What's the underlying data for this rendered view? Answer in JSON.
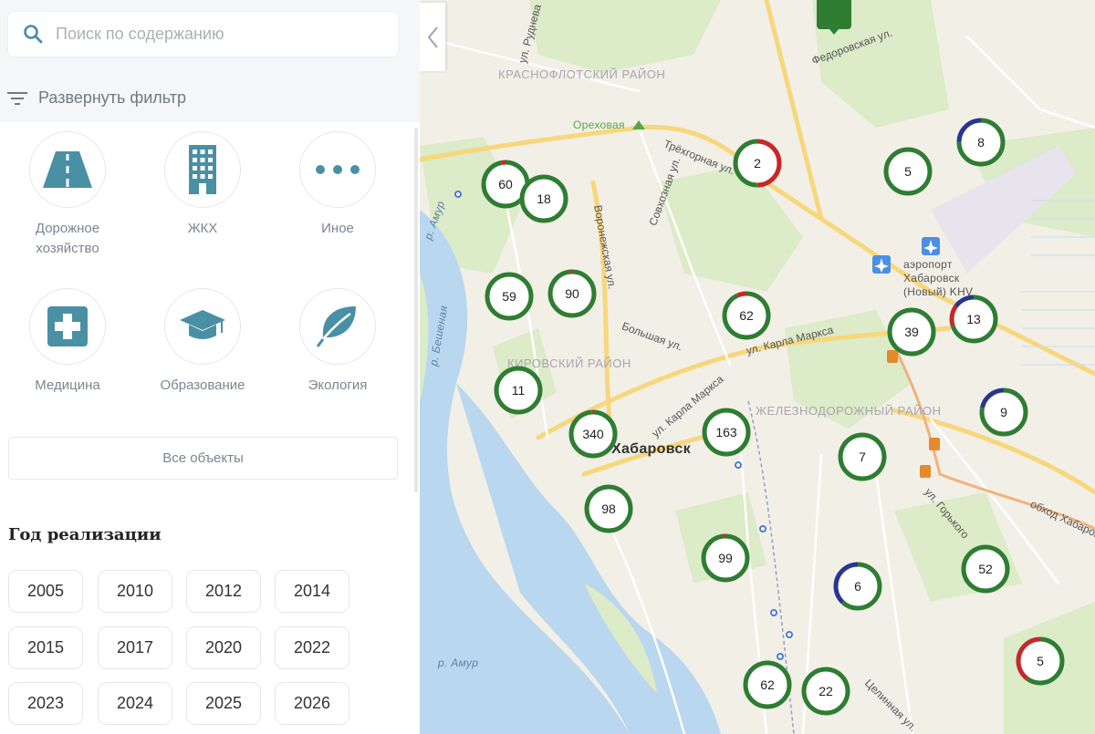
{
  "search": {
    "placeholder": "Поиск по содержанию"
  },
  "filter": {
    "label": "Развернуть фильтр"
  },
  "categories": [
    {
      "label": "Дорожное хозяйство",
      "icon": "road-icon"
    },
    {
      "label": "ЖКХ",
      "icon": "building-icon"
    },
    {
      "label": "Иное",
      "icon": "more-dots-icon"
    },
    {
      "label": "Медицина",
      "icon": "medical-cross-icon"
    },
    {
      "label": "Образование",
      "icon": "graduation-cap-icon"
    },
    {
      "label": "Экология",
      "icon": "leaf-icon"
    }
  ],
  "all_objects": {
    "label": "Все объекты"
  },
  "years": {
    "heading": "Год реализации",
    "items": [
      "2005",
      "2010",
      "2012",
      "2014",
      "2015",
      "2017",
      "2020",
      "2022",
      "2023",
      "2024",
      "2025",
      "2026"
    ]
  },
  "map": {
    "districts": [
      "КРАСНОФЛОТСКИЙ РАЙОН",
      "КИРОВСКИЙ РАЙОН",
      "ЖЕЛЕЗНОДОРОЖНЫЙ РАЙОН"
    ],
    "places": {
      "orekhovaya": "Ореховая",
      "airport": "аэропорт Хабаровск (Новый) KHV",
      "city": "Хабаровск",
      "amur1": "р. Амур",
      "amur2": "р. Амур",
      "besheniaya": "р. Бешеная"
    },
    "streets": [
      "Трёхгорная ул.",
      "Воронежская ул.",
      "Совхозная ул.",
      "Большая ул.",
      "ул. Карла Маркса",
      "ул. Карла Маркса",
      "ул. Горького",
      "обход Хабаровска",
      "Целинная ул.",
      "ул. Руднева",
      "Федоровская ул."
    ],
    "clusters": [
      {
        "count": "60",
        "segments": [
          {
            "color": "#2e7d32",
            "value": 0.97
          },
          {
            "color": "#c62828",
            "value": 0.03
          }
        ]
      },
      {
        "count": "18",
        "segments": [
          {
            "color": "#2e7d32",
            "value": 1
          }
        ]
      },
      {
        "count": "2",
        "segments": [
          {
            "color": "#c62828",
            "value": 0.5
          },
          {
            "color": "#2e7d32",
            "value": 0.5
          }
        ]
      },
      {
        "count": "5",
        "segments": [
          {
            "color": "#2e7d32",
            "value": 1
          }
        ]
      },
      {
        "count": "8",
        "segments": [
          {
            "color": "#2e7d32",
            "value": 0.75
          },
          {
            "color": "#283593",
            "value": 0.25
          }
        ]
      },
      {
        "count": "59",
        "segments": [
          {
            "color": "#2e7d32",
            "value": 1
          }
        ]
      },
      {
        "count": "90",
        "segments": [
          {
            "color": "#2e7d32",
            "value": 0.98
          },
          {
            "color": "#c62828",
            "value": 0.02
          }
        ]
      },
      {
        "count": "62",
        "segments": [
          {
            "color": "#2e7d32",
            "value": 0.93
          },
          {
            "color": "#c62828",
            "value": 0.07
          }
        ]
      },
      {
        "count": "39",
        "segments": [
          {
            "color": "#2e7d32",
            "value": 1
          }
        ]
      },
      {
        "count": "13",
        "segments": [
          {
            "color": "#2e7d32",
            "value": 0.7
          },
          {
            "color": "#c62828",
            "value": 0.15
          },
          {
            "color": "#283593",
            "value": 0.15
          }
        ]
      },
      {
        "count": "11",
        "segments": [
          {
            "color": "#2e7d32",
            "value": 1
          }
        ]
      },
      {
        "count": "340",
        "segments": [
          {
            "color": "#2e7d32",
            "value": 0.99
          },
          {
            "color": "#c62828",
            "value": 0.01
          }
        ]
      },
      {
        "count": "163",
        "segments": [
          {
            "color": "#2e7d32",
            "value": 1
          }
        ]
      },
      {
        "count": "7",
        "segments": [
          {
            "color": "#2e7d32",
            "value": 1
          }
        ]
      },
      {
        "count": "9",
        "segments": [
          {
            "color": "#2e7d32",
            "value": 0.78
          },
          {
            "color": "#283593",
            "value": 0.22
          }
        ]
      },
      {
        "count": "98",
        "segments": [
          {
            "color": "#2e7d32",
            "value": 1
          }
        ]
      },
      {
        "count": "99",
        "segments": [
          {
            "color": "#2e7d32",
            "value": 0.98
          },
          {
            "color": "#c62828",
            "value": 0.02
          }
        ]
      },
      {
        "count": "6",
        "segments": [
          {
            "color": "#2e7d32",
            "value": 0.62
          },
          {
            "color": "#283593",
            "value": 0.38
          }
        ]
      },
      {
        "count": "52",
        "segments": [
          {
            "color": "#2e7d32",
            "value": 1
          }
        ]
      },
      {
        "count": "62",
        "segments": [
          {
            "color": "#2e7d32",
            "value": 1
          }
        ]
      },
      {
        "count": "22",
        "segments": [
          {
            "color": "#2e7d32",
            "value": 1
          }
        ]
      },
      {
        "count": "5",
        "segments": [
          {
            "color": "#2e7d32",
            "value": 0.6
          },
          {
            "color": "#c62828",
            "value": 0.4
          }
        ]
      }
    ]
  },
  "colors": {
    "accent": "#4a90a4",
    "cluster_green": "#2e7d32",
    "cluster_red": "#c62828",
    "cluster_blue": "#283593",
    "water": "#b9d7ef",
    "park": "#d8e9c4",
    "road_major": "#f7d77b"
  }
}
